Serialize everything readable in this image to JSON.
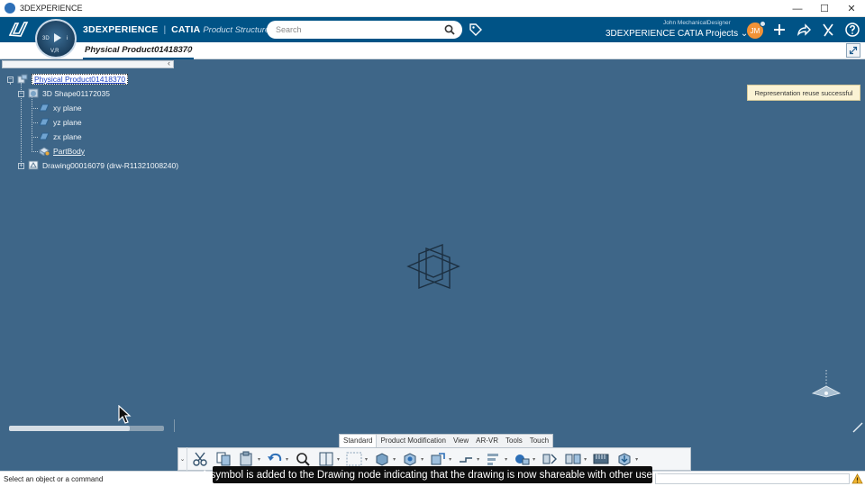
{
  "window": {
    "title": "3DEXPERIENCE",
    "minimize": "—",
    "maximize": "☐",
    "close": "✕"
  },
  "topbar": {
    "brand_prefix": "3DEXPERIENCE",
    "brand_sep": "|",
    "brand_product": "CATIA",
    "brand_app": "Product Structure Des...",
    "compass_labels": [
      "3D",
      "V,R",
      "i"
    ],
    "search_placeholder": "Search",
    "user_name": "John MechanicalDesigner",
    "space_name": "3DEXPERIENCE CATIA Projects",
    "space_chevron": "⌄",
    "avatar_initials": "JM",
    "icons": [
      "search-icon",
      "tag-icon",
      "add-icon",
      "share-icon",
      "compass-tools-icon",
      "help-icon"
    ]
  },
  "tabs": {
    "active": "Physical Product01418370",
    "add": "+"
  },
  "tree": {
    "collapse": "‹",
    "nodes": [
      {
        "label": "Physical Product01418370",
        "level": 0,
        "icon": "product-icon"
      },
      {
        "label": "3D Shape01172035",
        "level": 1,
        "icon": "shape-icon"
      },
      {
        "label": "xy plane",
        "level": 2,
        "icon": "plane-icon"
      },
      {
        "label": "yz plane",
        "level": 2,
        "icon": "plane-icon"
      },
      {
        "label": "zx plane",
        "level": 2,
        "icon": "plane-icon"
      },
      {
        "label": "PartBody",
        "level": 2,
        "icon": "partbody-icon"
      },
      {
        "label": "Drawing00016079 (drw-R1132100824​0)",
        "level": 1,
        "icon": "drawing-icon"
      }
    ]
  },
  "notification": "Representation reuse successful",
  "action_bar": {
    "tabs": [
      "Standard",
      "Product Modification",
      "View",
      "AR-VR",
      "Tools",
      "Touch"
    ],
    "active_tab": "Standard",
    "collapse": "⌄",
    "icons": [
      "cut-icon",
      "copy-icon",
      "paste-icon",
      "undo-icon",
      "zoom-icon",
      "book-icon",
      "select-icon",
      "part-icon",
      "assembly-icon",
      "insert-icon",
      "replace-icon",
      "sort-icon",
      "reorder-icon",
      "snap-icon",
      "scene-icon",
      "ruler-icon",
      "publish-icon"
    ]
  },
  "status": {
    "text": "Select an object or a command"
  },
  "caption": "A symbol is added to the Drawing node indicating that the drawing is now shareable with other users.",
  "colors": {
    "canvas": "#3e6688",
    "topbar": "#005386",
    "selection": "#2145c4",
    "avatar": "#f19237"
  }
}
